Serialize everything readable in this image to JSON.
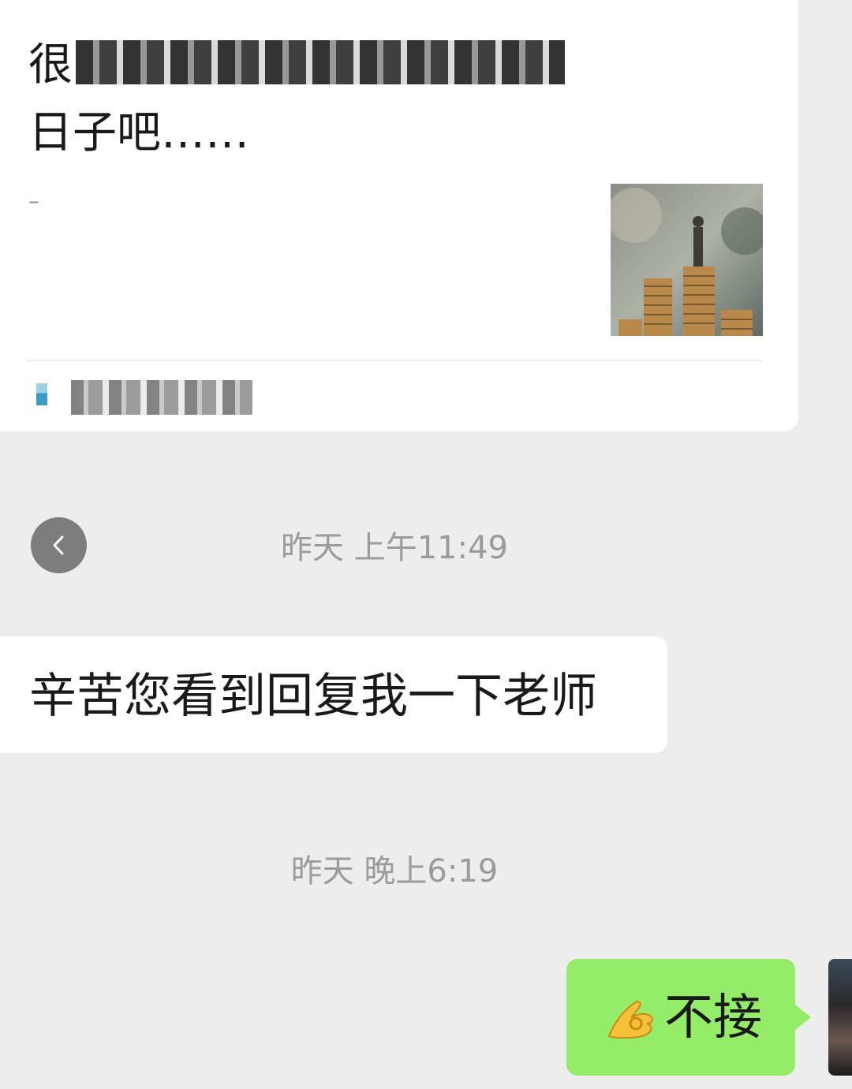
{
  "article": {
    "title_line1_visible": "很",
    "title_line1_end": "，",
    "title_line2": "日子吧……",
    "digest": "–",
    "source_name": ""
  },
  "messages": [
    {
      "type": "timestamp",
      "text": "昨天 上午11:49"
    },
    {
      "type": "incoming",
      "text": "辛苦您看到回复我一下老师"
    },
    {
      "type": "timestamp",
      "text": "昨天 晚上6:19"
    },
    {
      "type": "outgoing",
      "emoji": "ok-hand",
      "text": "不接"
    }
  ],
  "colors": {
    "background": "#ededed",
    "incoming_bubble": "#ffffff",
    "outgoing_bubble": "#95ec69",
    "timestamp_text": "#9b9b9b"
  },
  "icons": {
    "back": "chevron-left-icon",
    "emoji": "ok-hand-icon"
  }
}
